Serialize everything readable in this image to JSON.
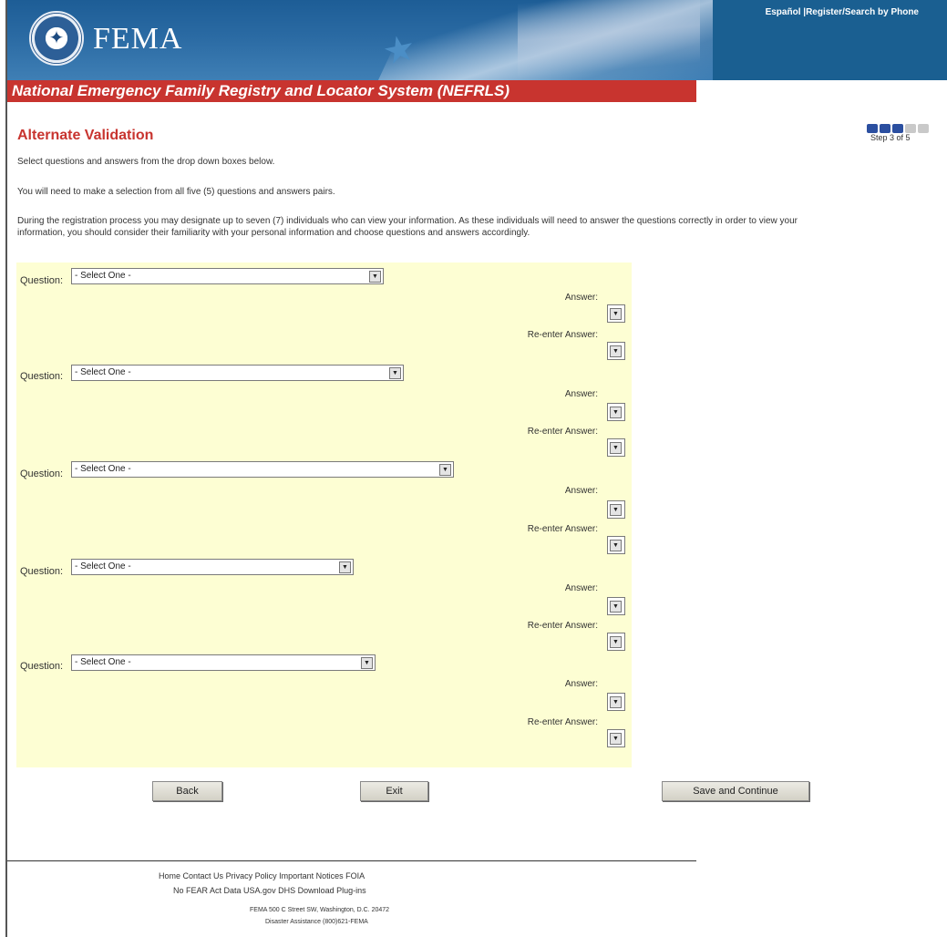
{
  "header": {
    "brand": "FEMA",
    "toplinks": [
      "Español",
      "Register",
      "Search by Phone"
    ],
    "title": "National Emergency Family Registry and Locator System (NEFRLS)"
  },
  "steps": {
    "total": 5,
    "current": 3,
    "label": "Step 3 of 5"
  },
  "main": {
    "heading": "Alternate Validation",
    "instructions": [
      "Select questions and answers from the drop down boxes below.",
      "You will need to make a selection from all five (5) questions and answers pairs.",
      "During the registration process you may designate up to seven (7) individuals who can view your information. As these individuals will need to answer the questions correctly in order to view your information, you should consider their familiarity with your personal information and choose questions and answers accordingly."
    ],
    "question_label": "Question:",
    "answer_label": "Answer:",
    "reenter_label": "Re-enter Answer:",
    "questions": [
      {
        "selected": "- Select One -"
      },
      {
        "selected": "- Select One -"
      },
      {
        "selected": "- Select One -"
      },
      {
        "selected": "- Select One -"
      },
      {
        "selected": "- Select One -"
      }
    ]
  },
  "buttons": {
    "back": "Back",
    "exit": "Exit",
    "save": "Save and Continue"
  },
  "footer": {
    "links_row1": [
      "Home",
      "Contact Us",
      "Privacy Policy",
      "Important Notices",
      "FOIA"
    ],
    "links_row2": [
      "No FEAR Act Data",
      "USA.gov",
      "DHS",
      "Download Plug-ins"
    ],
    "address": "FEMA 500 C Street SW, Washington, D.C. 20472",
    "assistance": "Disaster Assistance (800)621-FEMA"
  },
  "colors": {
    "header_blue": "#1a5a94",
    "title_red": "#c8342f",
    "panel_yellow": "#fdfed3",
    "step_on": "#2b4fa0",
    "step_off": "#c9c9c9"
  }
}
